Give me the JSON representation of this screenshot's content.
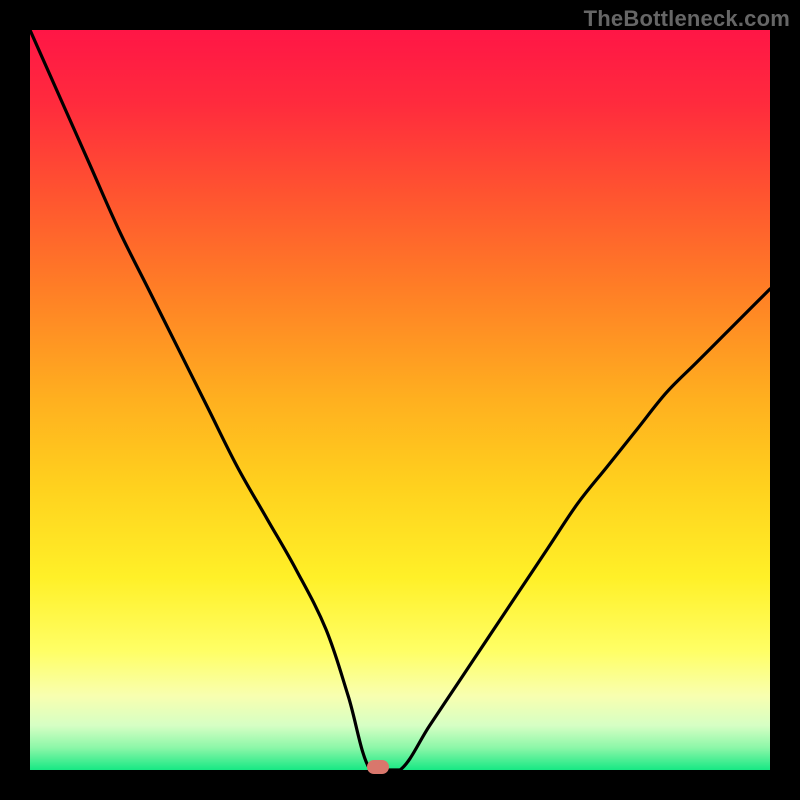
{
  "watermark": "TheBottleneck.com",
  "colors": {
    "frame": "#000000",
    "curve": "#000000",
    "marker": "#d9776c",
    "gradient_stops": [
      {
        "offset": 0.0,
        "color": "#ff1646"
      },
      {
        "offset": 0.1,
        "color": "#ff2b3d"
      },
      {
        "offset": 0.22,
        "color": "#ff5330"
      },
      {
        "offset": 0.35,
        "color": "#ff7e26"
      },
      {
        "offset": 0.5,
        "color": "#ffb01f"
      },
      {
        "offset": 0.62,
        "color": "#ffd21e"
      },
      {
        "offset": 0.74,
        "color": "#fff028"
      },
      {
        "offset": 0.84,
        "color": "#ffff66"
      },
      {
        "offset": 0.9,
        "color": "#f8ffb0"
      },
      {
        "offset": 0.94,
        "color": "#d6ffc4"
      },
      {
        "offset": 0.97,
        "color": "#8cf7a8"
      },
      {
        "offset": 1.0,
        "color": "#17e884"
      }
    ]
  },
  "plot": {
    "x_range": [
      0,
      100
    ],
    "y_range": [
      0,
      100
    ],
    "marker_x": 47,
    "marker_y": 0.4,
    "flat_segment_x": [
      43,
      50
    ]
  },
  "chart_data": {
    "type": "line",
    "title": "",
    "xlabel": "",
    "ylabel": "",
    "xlim": [
      0,
      100
    ],
    "ylim": [
      0,
      100
    ],
    "x": [
      0,
      4,
      8,
      12,
      16,
      20,
      24,
      28,
      32,
      36,
      40,
      43,
      46,
      50,
      54,
      58,
      62,
      66,
      70,
      74,
      78,
      82,
      86,
      90,
      94,
      98,
      100
    ],
    "values": [
      100,
      91,
      82,
      73,
      65,
      57,
      49,
      41,
      34,
      27,
      19,
      10,
      0,
      0,
      6,
      12,
      18,
      24,
      30,
      36,
      41,
      46,
      51,
      55,
      59,
      63,
      65
    ],
    "min_marker": {
      "x": 47,
      "y": 0.4
    },
    "watermark": "TheBottleneck.com"
  }
}
